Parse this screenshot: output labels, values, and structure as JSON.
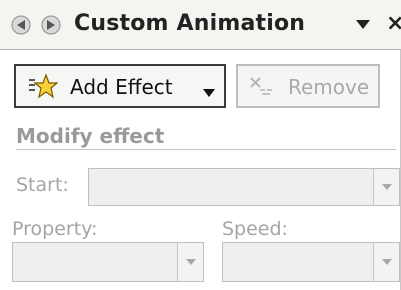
{
  "pane": {
    "title": "Custom Animation",
    "icons": {
      "back": "back-arrow-icon",
      "forward": "forward-arrow-icon",
      "menu": "dropdown-menu-icon",
      "close": "close-icon"
    }
  },
  "toolbar": {
    "add_effect_label": "Add Effect",
    "remove_label": "Remove"
  },
  "modify": {
    "heading": "Modify effect",
    "start_label": "Start:",
    "property_label": "Property:",
    "speed_label": "Speed:",
    "start_value": "",
    "property_value": "",
    "speed_value": ""
  },
  "colors": {
    "disabled_text": "#a5a5a5",
    "star_fill": "#f7d23a"
  }
}
